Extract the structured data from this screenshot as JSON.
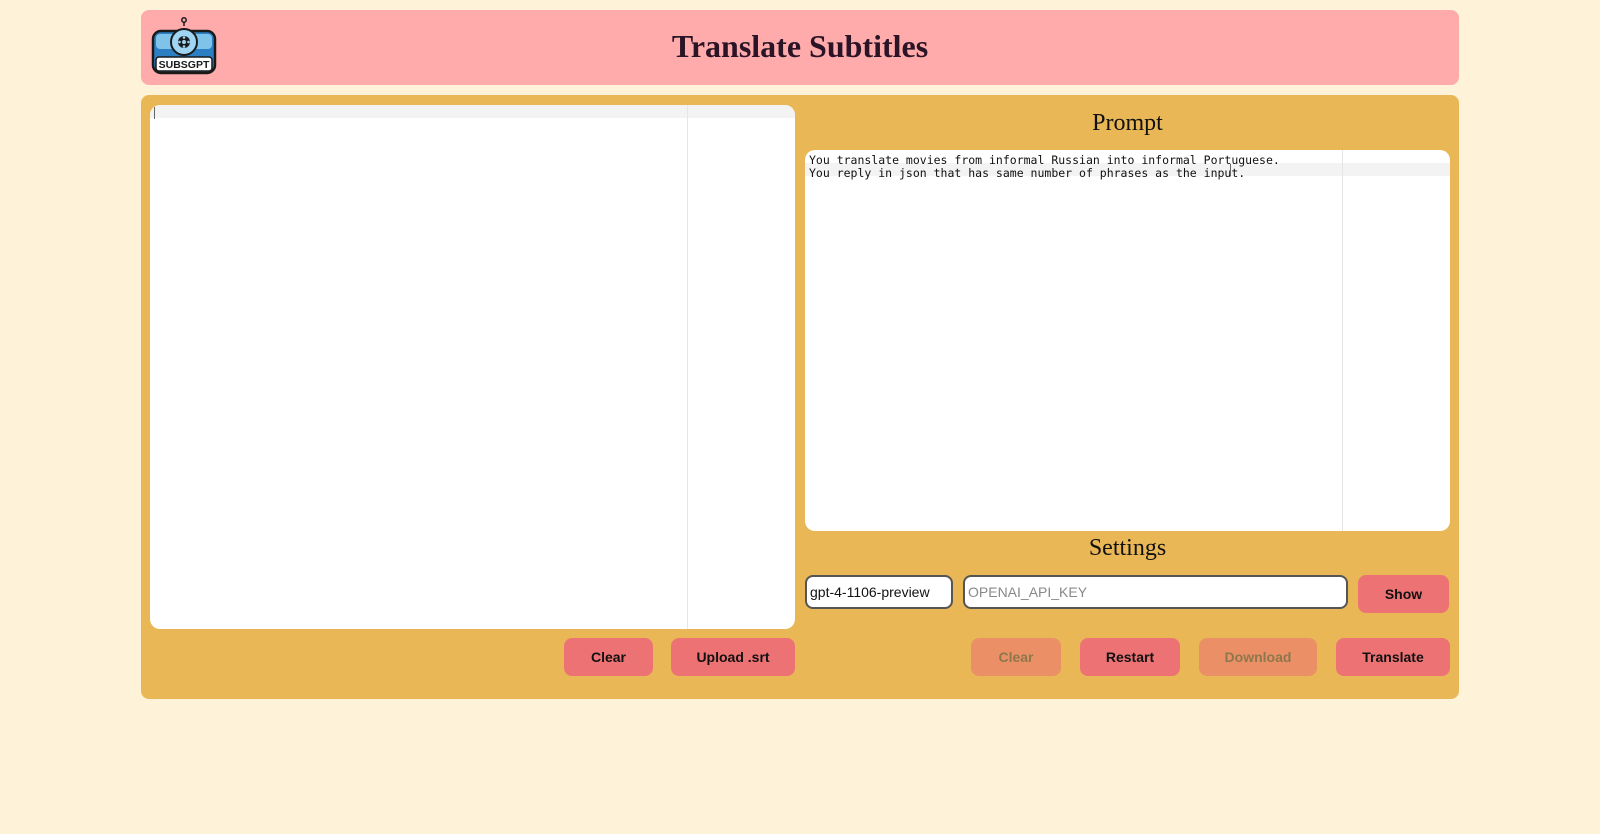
{
  "header": {
    "title": "Translate Subtitles",
    "logo_text": "SUBSGPT"
  },
  "subtitles_editor": {
    "lines": [
      ""
    ]
  },
  "prompt": {
    "title": "Prompt",
    "lines": [
      "You translate movies from informal Russian into informal Portuguese.",
      "You reply in json that has same number of phrases as the input."
    ]
  },
  "settings": {
    "title": "Settings",
    "model_value": "gpt-4-1106-preview",
    "api_key_placeholder": "OPENAI_API_KEY",
    "show_label": "Show"
  },
  "left_actions": {
    "clear_label": "Clear",
    "upload_label": "Upload .srt"
  },
  "right_actions": {
    "clear_label": "Clear",
    "restart_label": "Restart",
    "download_label": "Download",
    "translate_label": "Translate"
  },
  "colors": {
    "background": "#fef3d8",
    "header": "#ffaaab",
    "panel": "#eab756",
    "button": "#ed7274",
    "title_text": "#2a1426"
  }
}
